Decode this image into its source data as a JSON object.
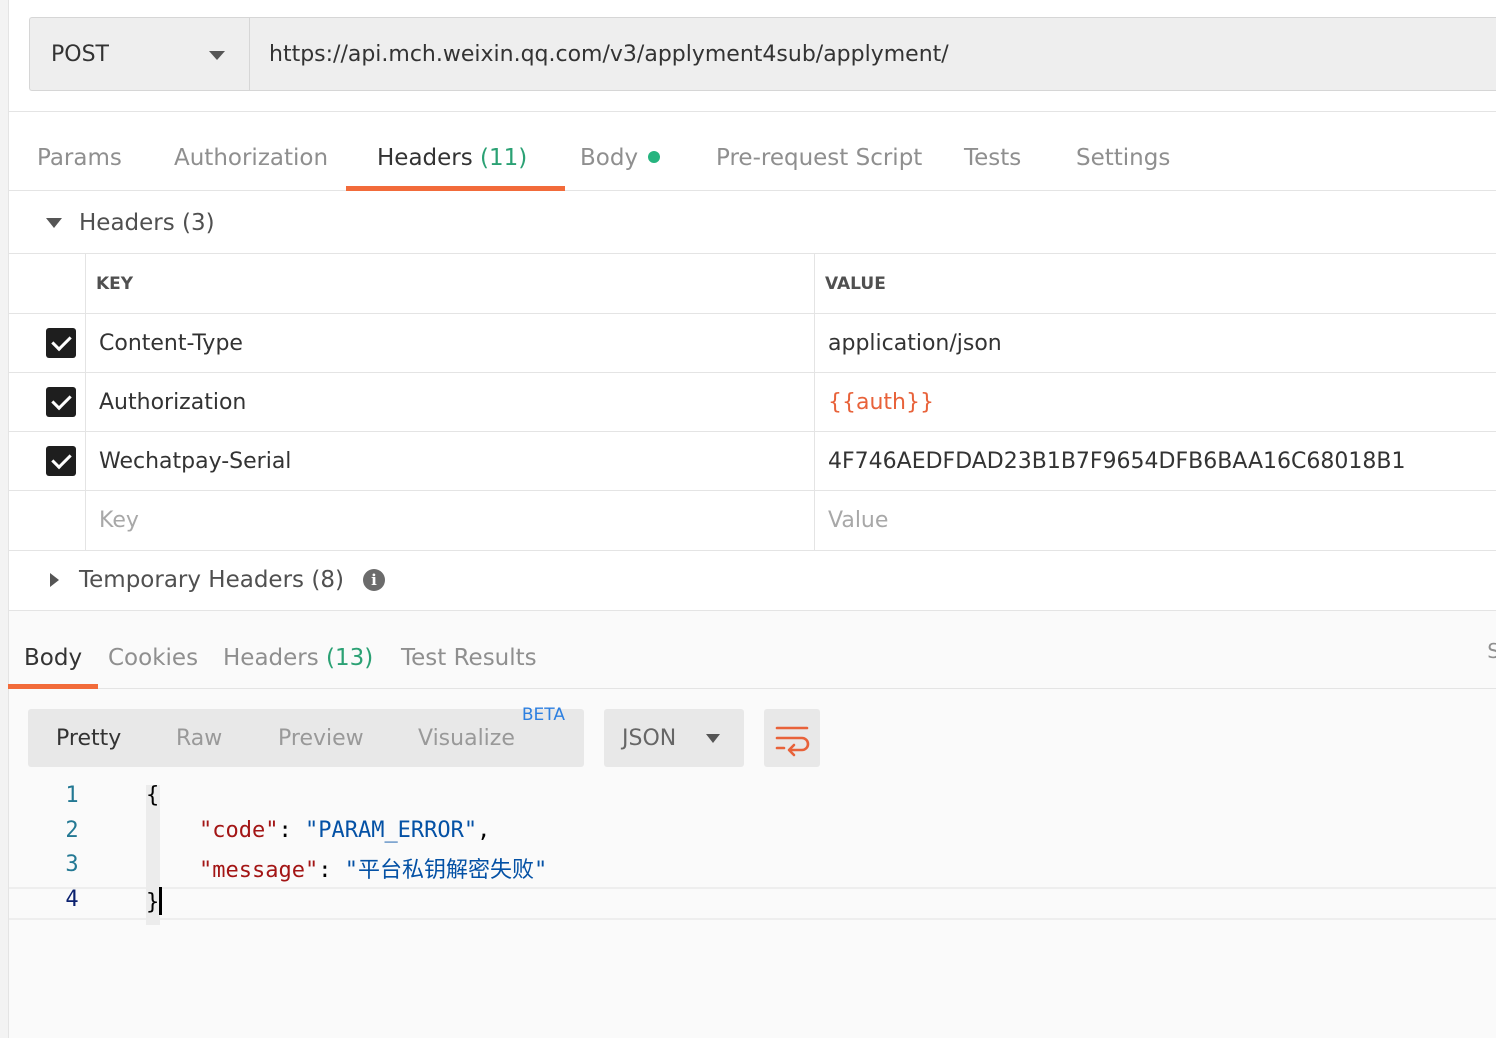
{
  "request": {
    "method": "POST",
    "url": "https://api.mch.weixin.qq.com/v3/applyment4sub/applyment/"
  },
  "request_tabs": [
    {
      "label": "Params"
    },
    {
      "label": "Authorization"
    },
    {
      "label": "Headers",
      "count": "(11)"
    },
    {
      "label": "Body"
    },
    {
      "label": "Pre-request Script"
    },
    {
      "label": "Tests"
    },
    {
      "label": "Settings"
    }
  ],
  "headers_section": {
    "title": "Headers",
    "count": "(3)",
    "columns": {
      "key": "KEY",
      "value": "VALUE"
    },
    "rows": [
      {
        "key": "Content-Type",
        "value": "application/json",
        "checked": true
      },
      {
        "key": "Authorization",
        "value": "{{auth}}",
        "checked": true
      },
      {
        "key": "Wechatpay-Serial",
        "value": "4F746AEDFDAD23B1B7F9654DFB6BAA16C68018B1",
        "checked": true
      }
    ],
    "new_row": {
      "key_placeholder": "Key",
      "value_placeholder": "Value"
    }
  },
  "temporary_headers": {
    "title": "Temporary Headers",
    "count": "(8)",
    "info_glyph": "i"
  },
  "response_tabs": [
    {
      "label": "Body"
    },
    {
      "label": "Cookies"
    },
    {
      "label": "Headers",
      "count": "(13)"
    },
    {
      "label": "Test Results"
    }
  ],
  "response_edge_text": "S",
  "view_modes": [
    {
      "label": "Pretty"
    },
    {
      "label": "Raw"
    },
    {
      "label": "Preview"
    },
    {
      "label": "Visualize",
      "badge": "BETA"
    }
  ],
  "format": "JSON",
  "code": {
    "line_numbers": [
      "1",
      "2",
      "3",
      "4"
    ],
    "open_brace": "{",
    "close_brace": "}",
    "code_key": "\"code\"",
    "code_value": "\"PARAM_ERROR\"",
    "message_key": "\"message\"",
    "message_value": "\"平台私钥解密失败\"",
    "colon": ": ",
    "comma": ","
  },
  "colors": {
    "accent": "#f26b3a",
    "count_green": "#2ba174",
    "variable_orange": "#e8623a",
    "beta_blue": "#2c7fe0"
  }
}
